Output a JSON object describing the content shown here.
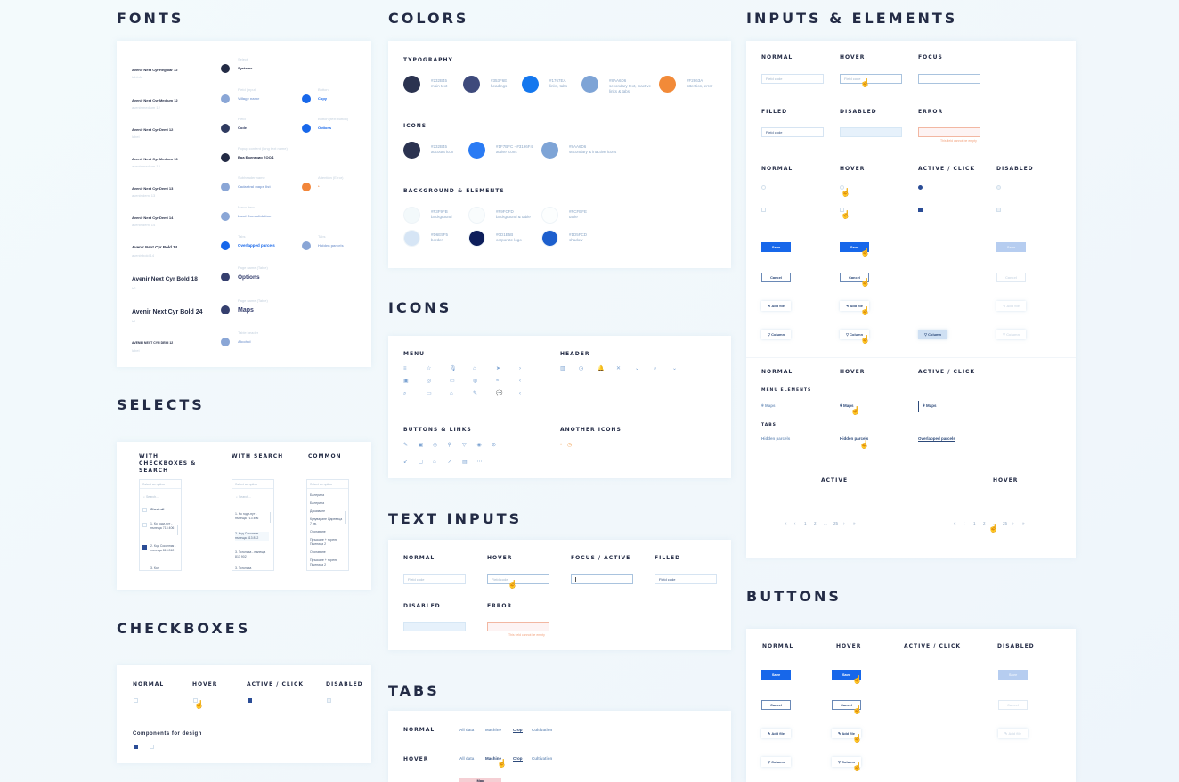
{
  "sections": {
    "fonts": "FONTS",
    "colors": "COLORS",
    "inputs": "INPUTS & ELEMENTS",
    "selects": "SELECTS",
    "checkboxes": "CHECKBOXES",
    "icons": "ICONS",
    "text_inputs": "TEXT INPUTS",
    "tabs": "TABS",
    "buttons": "BUTTONS"
  },
  "fonts": {
    "left": [
      {
        "name": "Avenir Next Cyr Regular 12",
        "sub": "tabInfo"
      },
      {
        "name": "Avenir Next Cyr Medium 12",
        "sub": "avenir medium 12"
      },
      {
        "name": "Avenir Next Cyr Demi 12",
        "sub": "label"
      },
      {
        "name": "Avenir Next Cyr Medium 13",
        "sub": "avenir medium 13"
      },
      {
        "name": "Avenir Next Cyr Demi 13",
        "sub": "avenir demi 13"
      },
      {
        "name": "Avenir Next Cyr Demi 14",
        "sub": "avenir demi 14"
      },
      {
        "name": "Avenir Next Cyr Bold 14",
        "sub": "avenir bold 14"
      },
      {
        "name": "Avenir Next Cyr Bold 18",
        "sub": "h2"
      },
      {
        "name": "Avenir Next Cyr Bold 24",
        "sub": "h1"
      },
      {
        "name": "AVENIR NEXT CYR DEMI 12",
        "sub": "label"
      }
    ],
    "samples": [
      {
        "caption": "Select",
        "text": "Systems",
        "color": "#232b45"
      },
      {
        "caption": "Field (input)",
        "text": "Village name",
        "color": "#8aa6d6"
      },
      {
        "caption": "Field",
        "text": "Code",
        "color": "#2f3a60"
      },
      {
        "caption": "Popup content (long text name)",
        "text": "Вра Болгарии ЕООД",
        "color": "#232b45"
      },
      {
        "caption": "Subheader name",
        "text": "Cadastral maps list",
        "color": "#8aa6d6"
      },
      {
        "caption": "Menu item",
        "text": "Land Consolidation",
        "color": "#8aa6d6"
      },
      {
        "caption": "Tabs",
        "text": "Overlapped parcels",
        "color": "#1767ea"
      },
      {
        "caption": "Page name (Table)",
        "text": "Options",
        "color": "#353f6e"
      },
      {
        "caption": "Page name (Table)",
        "text": "Maps",
        "color": "#353f6e"
      },
      {
        "caption": "Table header",
        "text": "Alcohol",
        "color": "#8aa6d6"
      }
    ],
    "samples_right": [
      {
        "caption": "Button",
        "text": "Copy",
        "color": "#1767ea"
      },
      {
        "caption": "Button (text button)",
        "text": "Options",
        "color": "#1767ea"
      },
      {
        "caption": "Attention (Error)",
        "text": "*",
        "color": "#f2863a"
      },
      {
        "caption": "Tabs",
        "text": "Hidden parcels",
        "color": "#8aa6d6"
      }
    ]
  },
  "colors": {
    "typography_label": "TYPOGRAPHY",
    "typography": [
      {
        "hex": "#232B45",
        "desc": "main text",
        "color": "#2b3350"
      },
      {
        "hex": "#353F6E",
        "desc": "headings",
        "color": "#3e4a7c"
      },
      {
        "hex": "#1767EA",
        "desc": "links, tabs",
        "color": "#1477ee"
      },
      {
        "hex": "#8AA6D6",
        "desc": "secondary text, inactive links & tabs",
        "color": "#7ea4d6"
      },
      {
        "hex": "#F2863A",
        "desc": "attention, error",
        "color": "#f28a38"
      }
    ],
    "icons_label": "ICONS",
    "icons": [
      {
        "hex": "#232B45",
        "desc": "account icon",
        "color": "#2b3350"
      },
      {
        "hex": "#1F7BFC - #3196F4",
        "desc": "active icons",
        "color": "#2a7bf4"
      },
      {
        "hex": "#8AA6D6",
        "desc": "secondary & inactive icons",
        "color": "#7ea4d6"
      }
    ],
    "bg_label": "BACKGROUND & ELEMENTS",
    "bg": [
      {
        "hex": "#F3F9FB",
        "desc": "background",
        "color": "#f3f9fb"
      },
      {
        "hex": "#F9FCFD",
        "desc": "background & table",
        "color": "#f9fcfd"
      },
      {
        "hex": "#FCFEFE",
        "desc": "table",
        "color": "#fcfefe"
      },
      {
        "hex": "#D6E5F5",
        "desc": "border",
        "color": "#d6e5f5"
      },
      {
        "hex": "#0D1E5B",
        "desc": "corporate logo",
        "color": "#0d1e5b"
      },
      {
        "hex": "#1D5FCD",
        "desc": "shadow",
        "color": "#1d5fcd"
      }
    ]
  },
  "icons_panel": {
    "menu_label": "MENU",
    "header_label": "HEADER",
    "buttons_label": "BUTTONS & LINKS",
    "another_label": "ANOTHER ICONS",
    "menu_icons": [
      "≡",
      "☆",
      "🎙",
      "⌂",
      "➤",
      "›",
      "▣",
      "◎",
      "▭",
      "◍",
      "≈",
      "‹",
      "⌕",
      "▭",
      "⌂",
      "✎",
      "💬",
      "‹"
    ],
    "header_icons": [
      "▥",
      "◷",
      "🔔",
      "✕",
      "⌄",
      "⌕",
      "⌄"
    ],
    "button_icons": [
      "✎",
      "▣",
      "◎",
      "⚲",
      "▽",
      "◉",
      "⊘",
      "↙",
      "▢",
      "⌂",
      "↗",
      "▤",
      "⋯"
    ],
    "another_icons": [
      "•",
      "◷"
    ]
  },
  "inputs": {
    "normal": "NORMAL",
    "hover": "HOVER",
    "focus": "FOCUS",
    "filled": "FILLED",
    "disabled": "DISABLED",
    "error": "ERROR",
    "active_click": "ACTIVE / CLICK",
    "placeholder": "Field code",
    "filled_value": "Field code",
    "error_msg": "This field cannot be empty",
    "save": "Save",
    "cancel": "Cancel",
    "add_file": "Add file",
    "column": "Column",
    "menu_elements": "MENU ELEMENTS",
    "tabs": "TABS",
    "maps": "Maps",
    "hidden_parcels": "Hidden parcels",
    "overlapped_parcels": "Overlapped parcels",
    "active": "ACTIVE",
    "pagination": [
      "«",
      "‹",
      "1",
      "2",
      "...",
      "25",
      "›",
      "»"
    ]
  },
  "selects": {
    "with_checkboxes": "WITH CHECKBOXES & SEARCH",
    "with_search": "WITH SEARCH",
    "common": "COMMON",
    "placeholder": "Select an option",
    "search": "Search...",
    "check_all": "Check all",
    "cb_items": [
      "1. Ко годи-пут - пъпеща 713 406",
      "2. Код Соколник - пъпеща 813 812",
      "3. Кол"
    ],
    "search_items": [
      "1. Ко годи-пут - пъпеща 713 406",
      "2. Код Соколник - пъпеща 813 812",
      "3. Тоголиза - пъпеща 813 902",
      "3. Тоголиза"
    ],
    "common_items": [
      "Балерина",
      "Балерина",
      "Доказване",
      "Купуваране Царевица 7 лв.",
      "Окопаване",
      "Пръскане + торене Пшеница 2",
      "Окопаване",
      "Пръскане + торене Пшеница 2"
    ]
  },
  "checkboxes": {
    "normal": "NORMAL",
    "hover": "HOVER",
    "active": "ACTIVE / CLICK",
    "disabled": "DISABLED",
    "components": "Components for design"
  },
  "text_inputs": {
    "normal": "NORMAL",
    "hover": "HOVER",
    "focus": "FOCUS / ACTIVE",
    "filled": "FILLED",
    "disabled": "DISABLED",
    "error": "ERROR",
    "placeholder": "Field code",
    "filled_value": "Field code",
    "error_msg": "This field cannot be empty"
  },
  "tabs": {
    "normal": "NORMAL",
    "hover": "HOVER",
    "items": [
      "All data",
      "Machine",
      "Crop",
      "Cultivation"
    ],
    "active_index": 2,
    "badge": "Map"
  },
  "buttons": {
    "normal": "NORMAL",
    "hover": "HOVER",
    "active": "ACTIVE / CLICK",
    "disabled": "DISABLED",
    "save": "Save",
    "cancel": "Cancel",
    "add_file": "Add file",
    "column": "Column"
  }
}
